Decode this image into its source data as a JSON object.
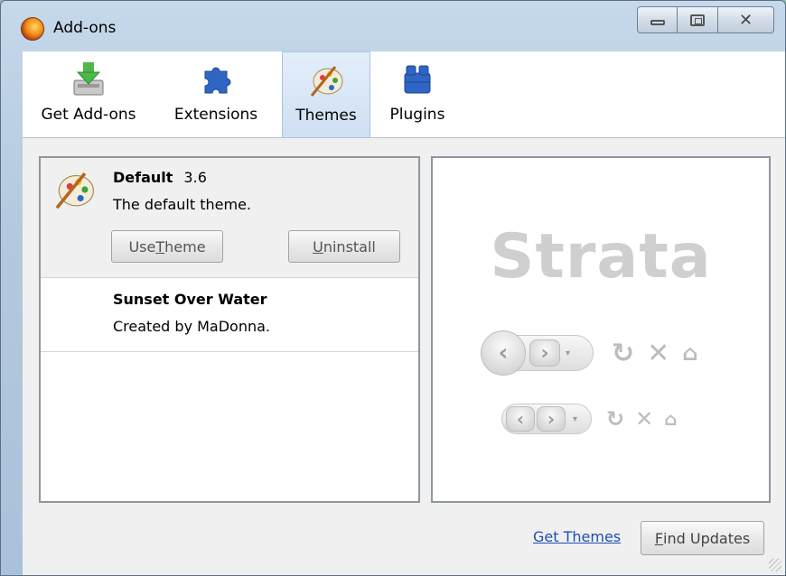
{
  "window": {
    "title": "Add-ons",
    "controls": {
      "minimize": "minimize",
      "maximize": "maximize",
      "close": "✕"
    }
  },
  "toolbar": {
    "tabs": [
      {
        "label": "Get Add-ons",
        "icon": "download-icon",
        "selected": false
      },
      {
        "label": "Extensions",
        "icon": "puzzle-icon",
        "selected": false
      },
      {
        "label": "Themes",
        "icon": "palette-icon",
        "selected": true
      },
      {
        "label": "Plugins",
        "icon": "plugin-blocks-icon",
        "selected": false
      }
    ]
  },
  "themes": [
    {
      "name": "Default",
      "version": "3.6",
      "description": "The default theme.",
      "selected": true,
      "buttons": {
        "use_theme": {
          "pre": "Use ",
          "ul": "T",
          "post": "heme"
        },
        "uninstall": {
          "pre": "",
          "ul": "U",
          "post": "ninstall"
        }
      }
    },
    {
      "name": "Sunset Over Water",
      "description": "Created by MaDonna.",
      "selected": false
    }
  ],
  "preview": {
    "title": "Strata"
  },
  "footer": {
    "get_themes_link": "Get Themes",
    "find_updates": {
      "pre": "",
      "ul": "F",
      "post": "ind Updates"
    }
  },
  "colors": {
    "link": "#1f4fb0",
    "selected_tab_bg": "#cfe0f3",
    "preview_text": "#cfcfcf"
  }
}
